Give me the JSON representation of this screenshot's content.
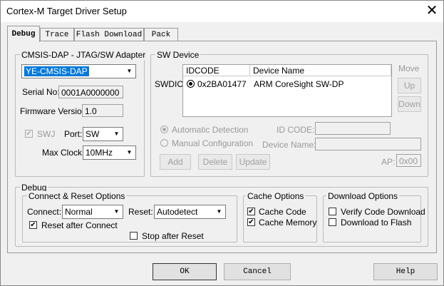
{
  "window": {
    "title": "Cortex-M Target Driver Setup",
    "close_symbol": "✕"
  },
  "tabs": [
    {
      "label": "Debug"
    },
    {
      "label": "Trace"
    },
    {
      "label": "Flash Download"
    },
    {
      "label": "Pack"
    }
  ],
  "adapter": {
    "group_label": "CMSIS-DAP - JTAG/SW Adapter",
    "selected": "YE-CMSIS-DAP",
    "serial_label": "Serial No:",
    "serial_value": "0001A0000000",
    "firmware_label": "Firmware Version:",
    "firmware_value": "1.0",
    "swj_label": "SWJ",
    "port_label": "Port:",
    "port_value": "SW",
    "maxclock_label": "Max Clock:",
    "maxclock_value": "10MHz"
  },
  "sw_device": {
    "group_label": "SW Device",
    "swdio_label": "SWDIO",
    "columns": [
      "IDCODE",
      "Device Name"
    ],
    "rows": [
      {
        "idcode": "0x2BA01477",
        "device_name": "ARM CoreSight SW-DP"
      }
    ],
    "move_label": "Move",
    "up_label": "Up",
    "down_label": "Down",
    "auto_detect_label": "Automatic Detection",
    "manual_config_label": "Manual Configuration",
    "id_code_label": "ID CODE:",
    "device_name_label": "Device Name:",
    "add_label": "Add",
    "delete_label": "Delete",
    "update_label": "Update",
    "ap_label": "AP:",
    "ap_value": "0x00"
  },
  "debug": {
    "group_label": "Debug",
    "connect_reset_label": "Connect & Reset Options",
    "connect_label": "Connect:",
    "connect_value": "Normal",
    "reset_label": "Reset:",
    "reset_value": "Autodetect",
    "reset_after_connect_label": "Reset after Connect",
    "stop_after_reset_label": "Stop after Reset",
    "cache_label": "Cache Options",
    "cache_code_label": "Cache Code",
    "cache_memory_label": "Cache Memory",
    "download_label": "Download Options",
    "verify_label": "Verify Code Download",
    "download_flash_label": "Download to Flash",
    "check_mark": "✔"
  },
  "footer": {
    "ok": "OK",
    "cancel": "Cancel",
    "help": "Help"
  },
  "icons": {
    "dropdown": "▼"
  }
}
